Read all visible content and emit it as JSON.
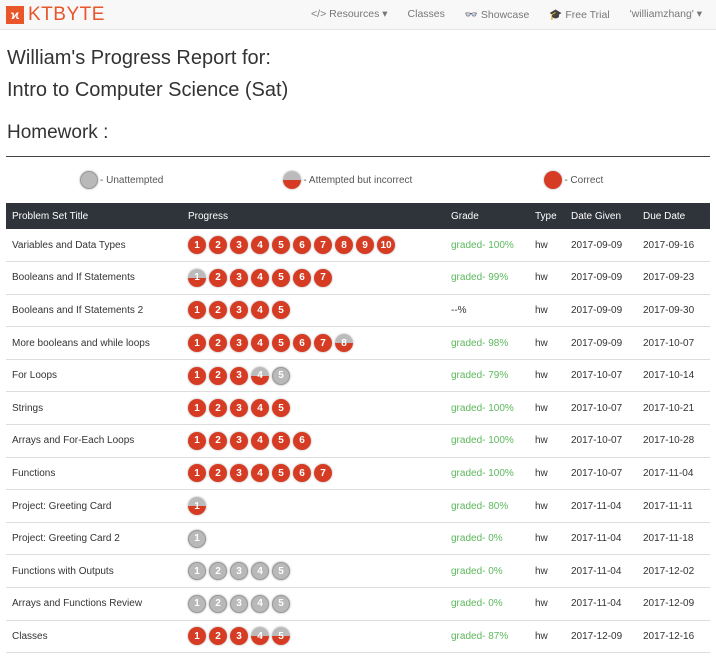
{
  "nav": {
    "brand": "KTBYTE",
    "resources": "</> Resources ▾",
    "classes": "Classes",
    "showcase": "Showcase",
    "free_trial": "Free Trial",
    "user": "'williamzhang' ▾"
  },
  "title_line1": "William's Progress Report for:",
  "title_line2": "Intro to Computer Science (Sat)",
  "section": "Homework :",
  "legend": {
    "unattempted": "- Unattempted",
    "attempted": "- Attempted but incorrect",
    "correct": "- Correct"
  },
  "colors": {
    "correct": "#d63c24",
    "unattempted": "#b9b9b9",
    "grade": "#5cb85c",
    "brand": "#e8562a"
  },
  "columns": [
    "Problem Set Title",
    "Progress",
    "Grade",
    "Type",
    "Date Given",
    "Due Date"
  ],
  "rows": [
    {
      "title": "Variables and Data Types",
      "progress": "cccccccccc",
      "grade": "graded- 100%",
      "type": "hw",
      "given": "2017-09-09",
      "due": "2017-09-16"
    },
    {
      "title": "Booleans and If Statements",
      "progress": "acccccc",
      "grade": "graded- 99%",
      "type": "hw",
      "given": "2017-09-09",
      "due": "2017-09-23"
    },
    {
      "title": "Booleans and If Statements 2",
      "progress": "ccccc",
      "grade": "--%",
      "type": "hw",
      "given": "2017-09-09",
      "due": "2017-09-30"
    },
    {
      "title": "More booleans and while loops",
      "progress": "ccccccca",
      "grade": "graded- 98%",
      "type": "hw",
      "given": "2017-09-09",
      "due": "2017-10-07"
    },
    {
      "title": "For Loops",
      "progress": "cccau",
      "grade": "graded- 79%",
      "type": "hw",
      "given": "2017-10-07",
      "due": "2017-10-14"
    },
    {
      "title": "Strings",
      "progress": "ccccc",
      "grade": "graded- 100%",
      "type": "hw",
      "given": "2017-10-07",
      "due": "2017-10-21"
    },
    {
      "title": "Arrays and For-Each Loops",
      "progress": "cccccc",
      "grade": "graded- 100%",
      "type": "hw",
      "given": "2017-10-07",
      "due": "2017-10-28"
    },
    {
      "title": "Functions",
      "progress": "ccccccc",
      "grade": "graded- 100%",
      "type": "hw",
      "given": "2017-10-07",
      "due": "2017-11-04"
    },
    {
      "title": "Project: Greeting Card",
      "progress": "a",
      "grade": "graded- 80%",
      "type": "hw",
      "given": "2017-11-04",
      "due": "2017-11-11"
    },
    {
      "title": "Project: Greeting Card 2",
      "progress": "u",
      "grade": "graded- 0%",
      "type": "hw",
      "given": "2017-11-04",
      "due": "2017-11-18"
    },
    {
      "title": "Functions with Outputs",
      "progress": "uuuuu",
      "grade": "graded- 0%",
      "type": "hw",
      "given": "2017-11-04",
      "due": "2017-12-02"
    },
    {
      "title": "Arrays and Functions Review",
      "progress": "uuuuu",
      "grade": "graded- 0%",
      "type": "hw",
      "given": "2017-11-04",
      "due": "2017-12-09"
    },
    {
      "title": "Classes",
      "progress": "cccaa",
      "grade": "graded- 87%",
      "type": "hw",
      "given": "2017-12-09",
      "due": "2017-12-16"
    }
  ]
}
